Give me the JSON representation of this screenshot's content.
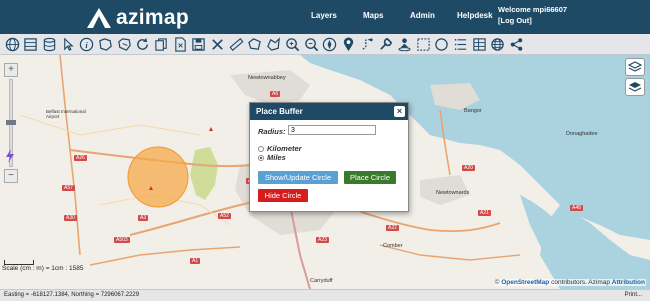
{
  "header": {
    "logo_text": "azimap",
    "nav": [
      "Layers",
      "Maps",
      "Admin",
      "Helpdesk"
    ],
    "welcome": "Welcome mpi66607",
    "logout": "[Log Out]"
  },
  "toolbar": {
    "tools": [
      "globe-icon",
      "layers-stack-icon",
      "database-icon",
      "pointer-icon",
      "info-icon",
      "select-area-icon",
      "pan-area-icon",
      "refresh-icon",
      "copy-icon",
      "delete-doc-icon",
      "save-icon",
      "clear-icon",
      "ruler-icon",
      "polygon-icon",
      "draw-area-icon",
      "zoom-in-icon",
      "zoom-out-icon",
      "pin-icon",
      "route-icon",
      "wrench-icon",
      "person-pin-icon",
      "area-select-icon",
      "buffer-circle-icon",
      "list-icon",
      "table-icon",
      "globe-settings-icon",
      "share-icon"
    ]
  },
  "map": {
    "places": [
      {
        "name": "Newtownabbey"
      },
      {
        "name": "Belfast International Airport"
      },
      {
        "name": "Bangor"
      },
      {
        "name": "Donaghadee"
      },
      {
        "name": "Newtownards"
      },
      {
        "name": "Comber"
      },
      {
        "name": "Carryduff"
      }
    ],
    "roads": [
      "A6",
      "A26",
      "A57",
      "A2",
      "A30",
      "A3",
      "A52",
      "A503",
      "A1",
      "A23",
      "A22",
      "A21",
      "A20",
      "A48",
      "A26"
    ],
    "scale_text": "Scale (cm : m) = 1cm : 1585",
    "scale_mini": "2 km\n1 mi",
    "attribution_prefix": "©",
    "osm_link": "OpenStreetMap",
    "attribution_middle": " contributors. Azimap ",
    "attribution_link": "Attribution"
  },
  "dialog": {
    "title": "Place Buffer",
    "close": "×",
    "radius_label": "Radius:",
    "radius_value": "3",
    "unit_kilometer": "Kilometer",
    "unit_miles": "Miles",
    "selected_unit": "Miles",
    "show_update_label": "Show/Update Circle",
    "place_label": "Place Circle",
    "hide_label": "Hide Circle"
  },
  "status": {
    "coords": "Easting = -618127.1384, Northing = 7296067.2229",
    "print": "Print..."
  },
  "colors": {
    "header_bg": "#1f4a66",
    "buffer_fill": "#f5a94a",
    "btn_show": "#5aa0d4",
    "btn_place": "#3a7a2d",
    "btn_hide": "#d61c1c"
  }
}
